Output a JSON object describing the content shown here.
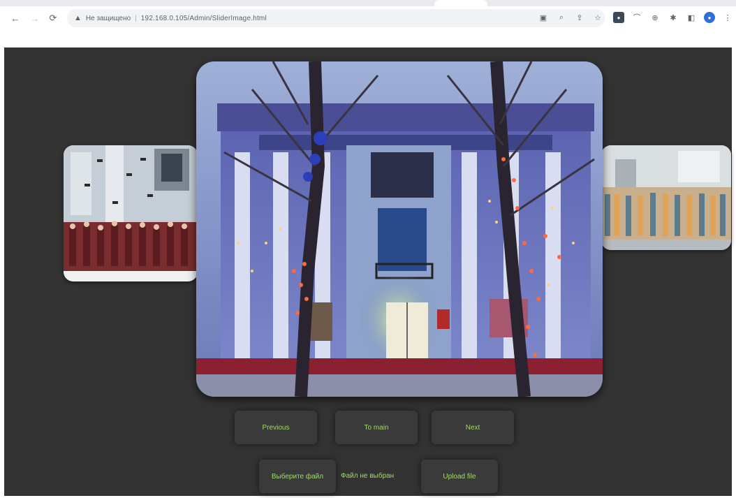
{
  "browser": {
    "back_icon": "←",
    "forward_icon": "→",
    "reload_icon": "⟳",
    "security_label": "Не защищено",
    "url": "192.168.0.105/Admin/SliderImage.html",
    "extension_icons": [
      "cast-icon",
      "zoom-icon",
      "share-icon",
      "star-icon",
      "extension-1-icon",
      "extension-2-icon",
      "extension-3-icon",
      "puzzle-icon",
      "sidebar-icon",
      "profile-avatar",
      "menu-icon"
    ]
  },
  "slider": {
    "prev_button": "Previous",
    "to_main_button": "To main",
    "next_button": "Next"
  },
  "upload": {
    "choose_file_button": "Выберите файл",
    "file_status": "Файл не выбран",
    "upload_button": "Upload file"
  },
  "colors": {
    "page_background": "#333333",
    "button_text": "#9fdc6a",
    "button_background": "#3a3a3a"
  }
}
